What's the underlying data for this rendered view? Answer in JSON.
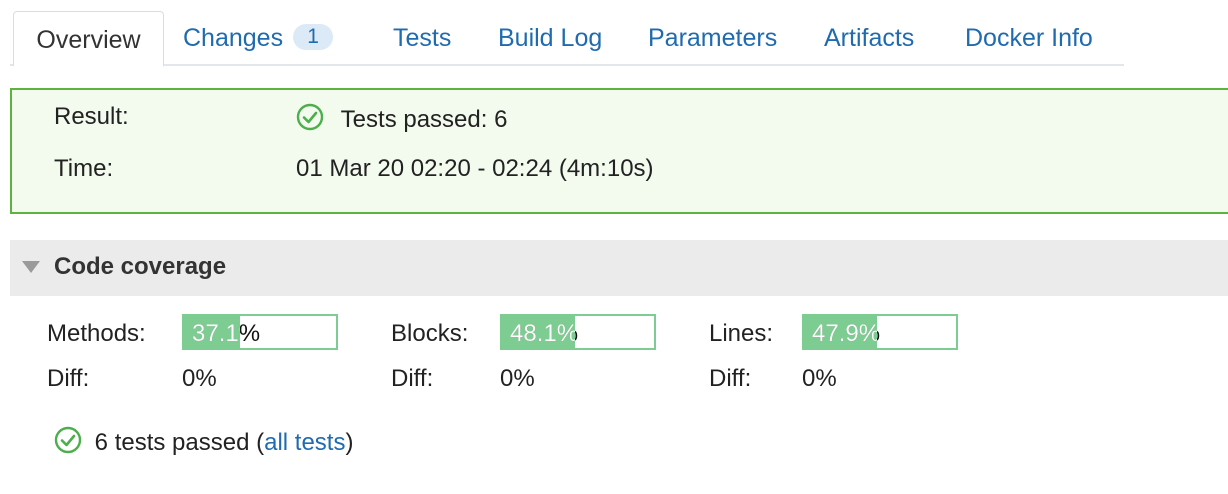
{
  "tabs": [
    {
      "label": "Overview",
      "active": true
    },
    {
      "label": "Changes",
      "badge": "1"
    },
    {
      "label": "Tests"
    },
    {
      "label": "Build Log"
    },
    {
      "label": "Parameters"
    },
    {
      "label": "Artifacts"
    },
    {
      "label": "Docker Info"
    }
  ],
  "result": {
    "result_label": "Result:",
    "result_value": "Tests passed: 6",
    "time_label": "Time:",
    "time_value": "01 Mar 20 02:20 - 02:24 (4m:10s)",
    "status_color": "#5db33d"
  },
  "coverage": {
    "title": "Code coverage",
    "metrics": [
      {
        "label": "Methods:",
        "value": "37.1%",
        "fraction": 0.371,
        "diff_label": "Diff:",
        "diff_value": "0%"
      },
      {
        "label": "Blocks:",
        "value": "48.1%",
        "fraction": 0.481,
        "diff_label": "Diff:",
        "diff_value": "0%"
      },
      {
        "label": "Lines:",
        "value": "47.9%",
        "fraction": 0.479,
        "diff_label": "Diff:",
        "diff_value": "0%"
      }
    ],
    "bar_color": "#7dcc91"
  },
  "footer": {
    "text_before": "6 tests passed (",
    "link": "all tests",
    "text_after": ")"
  },
  "icons": {
    "check": "check-circle-icon",
    "collapse": "triangle-down-icon"
  }
}
